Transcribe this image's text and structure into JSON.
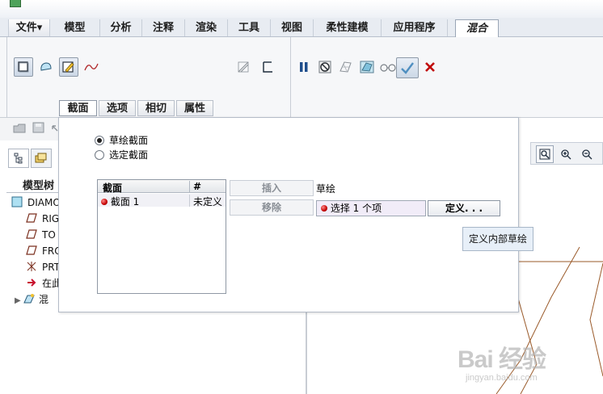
{
  "menu": {
    "tabs": [
      {
        "label": "文件▾"
      },
      {
        "label": "模型"
      },
      {
        "label": "分析"
      },
      {
        "label": "注释"
      },
      {
        "label": "渲染"
      },
      {
        "label": "工具"
      },
      {
        "label": "视图"
      },
      {
        "label": "柔性建模"
      },
      {
        "label": "应用程序"
      },
      {
        "label": "混合"
      }
    ],
    "active_tab": "混合"
  },
  "ribbon": {
    "left_icons": [
      "solid-icon",
      "surface-icon",
      "edit-sketch-icon",
      "curve-icon",
      "thicken-icon",
      "remove-material-icon"
    ],
    "right_icons": [
      "pause-icon",
      "no-preview-icon",
      "verification-preview-icon",
      "geometry-preview-icon",
      "glasses-icon",
      "ok-check-icon",
      "cancel-x-icon"
    ],
    "subtabs": [
      "截面",
      "选项",
      "相切",
      "属性"
    ],
    "active_subtab": "截面"
  },
  "left_panel": {
    "model_tree_title": "模型树",
    "tree": [
      {
        "label": "DIAMO",
        "icon": "part-icon"
      },
      {
        "label": "RIG",
        "icon": "datum-plane-icon"
      },
      {
        "label": "TO",
        "icon": "datum-plane-icon"
      },
      {
        "label": "FRO",
        "icon": "datum-plane-icon"
      },
      {
        "label": "PRT",
        "icon": "coordinate-system-icon"
      },
      {
        "label": "在此",
        "icon": "insert-arrow-icon"
      },
      {
        "label": "混",
        "icon": "blend-feature-icon"
      }
    ]
  },
  "dialog": {
    "radio_sketch": "草绘截面",
    "radio_selected": "选定截面",
    "table": {
      "headers": [
        "截面",
        "#"
      ],
      "rows": [
        {
          "name": "截面 1",
          "status": "未定义"
        }
      ]
    },
    "insert_label": "插入",
    "remove_label": "移除",
    "sketch_label": "草绘",
    "select_value": "选择 1 个项",
    "define_label": "定义. . .",
    "tooltip": "定义内部草绘"
  },
  "watermark": {
    "main": "Bai 经验",
    "sub": "jingyan.baidu.com"
  },
  "colors": {
    "accent_blue": "#1f4e8c",
    "ok_green": "#2e7d32",
    "cancel_red": "#c00000",
    "sketch_lines": "#9a5a2a"
  }
}
